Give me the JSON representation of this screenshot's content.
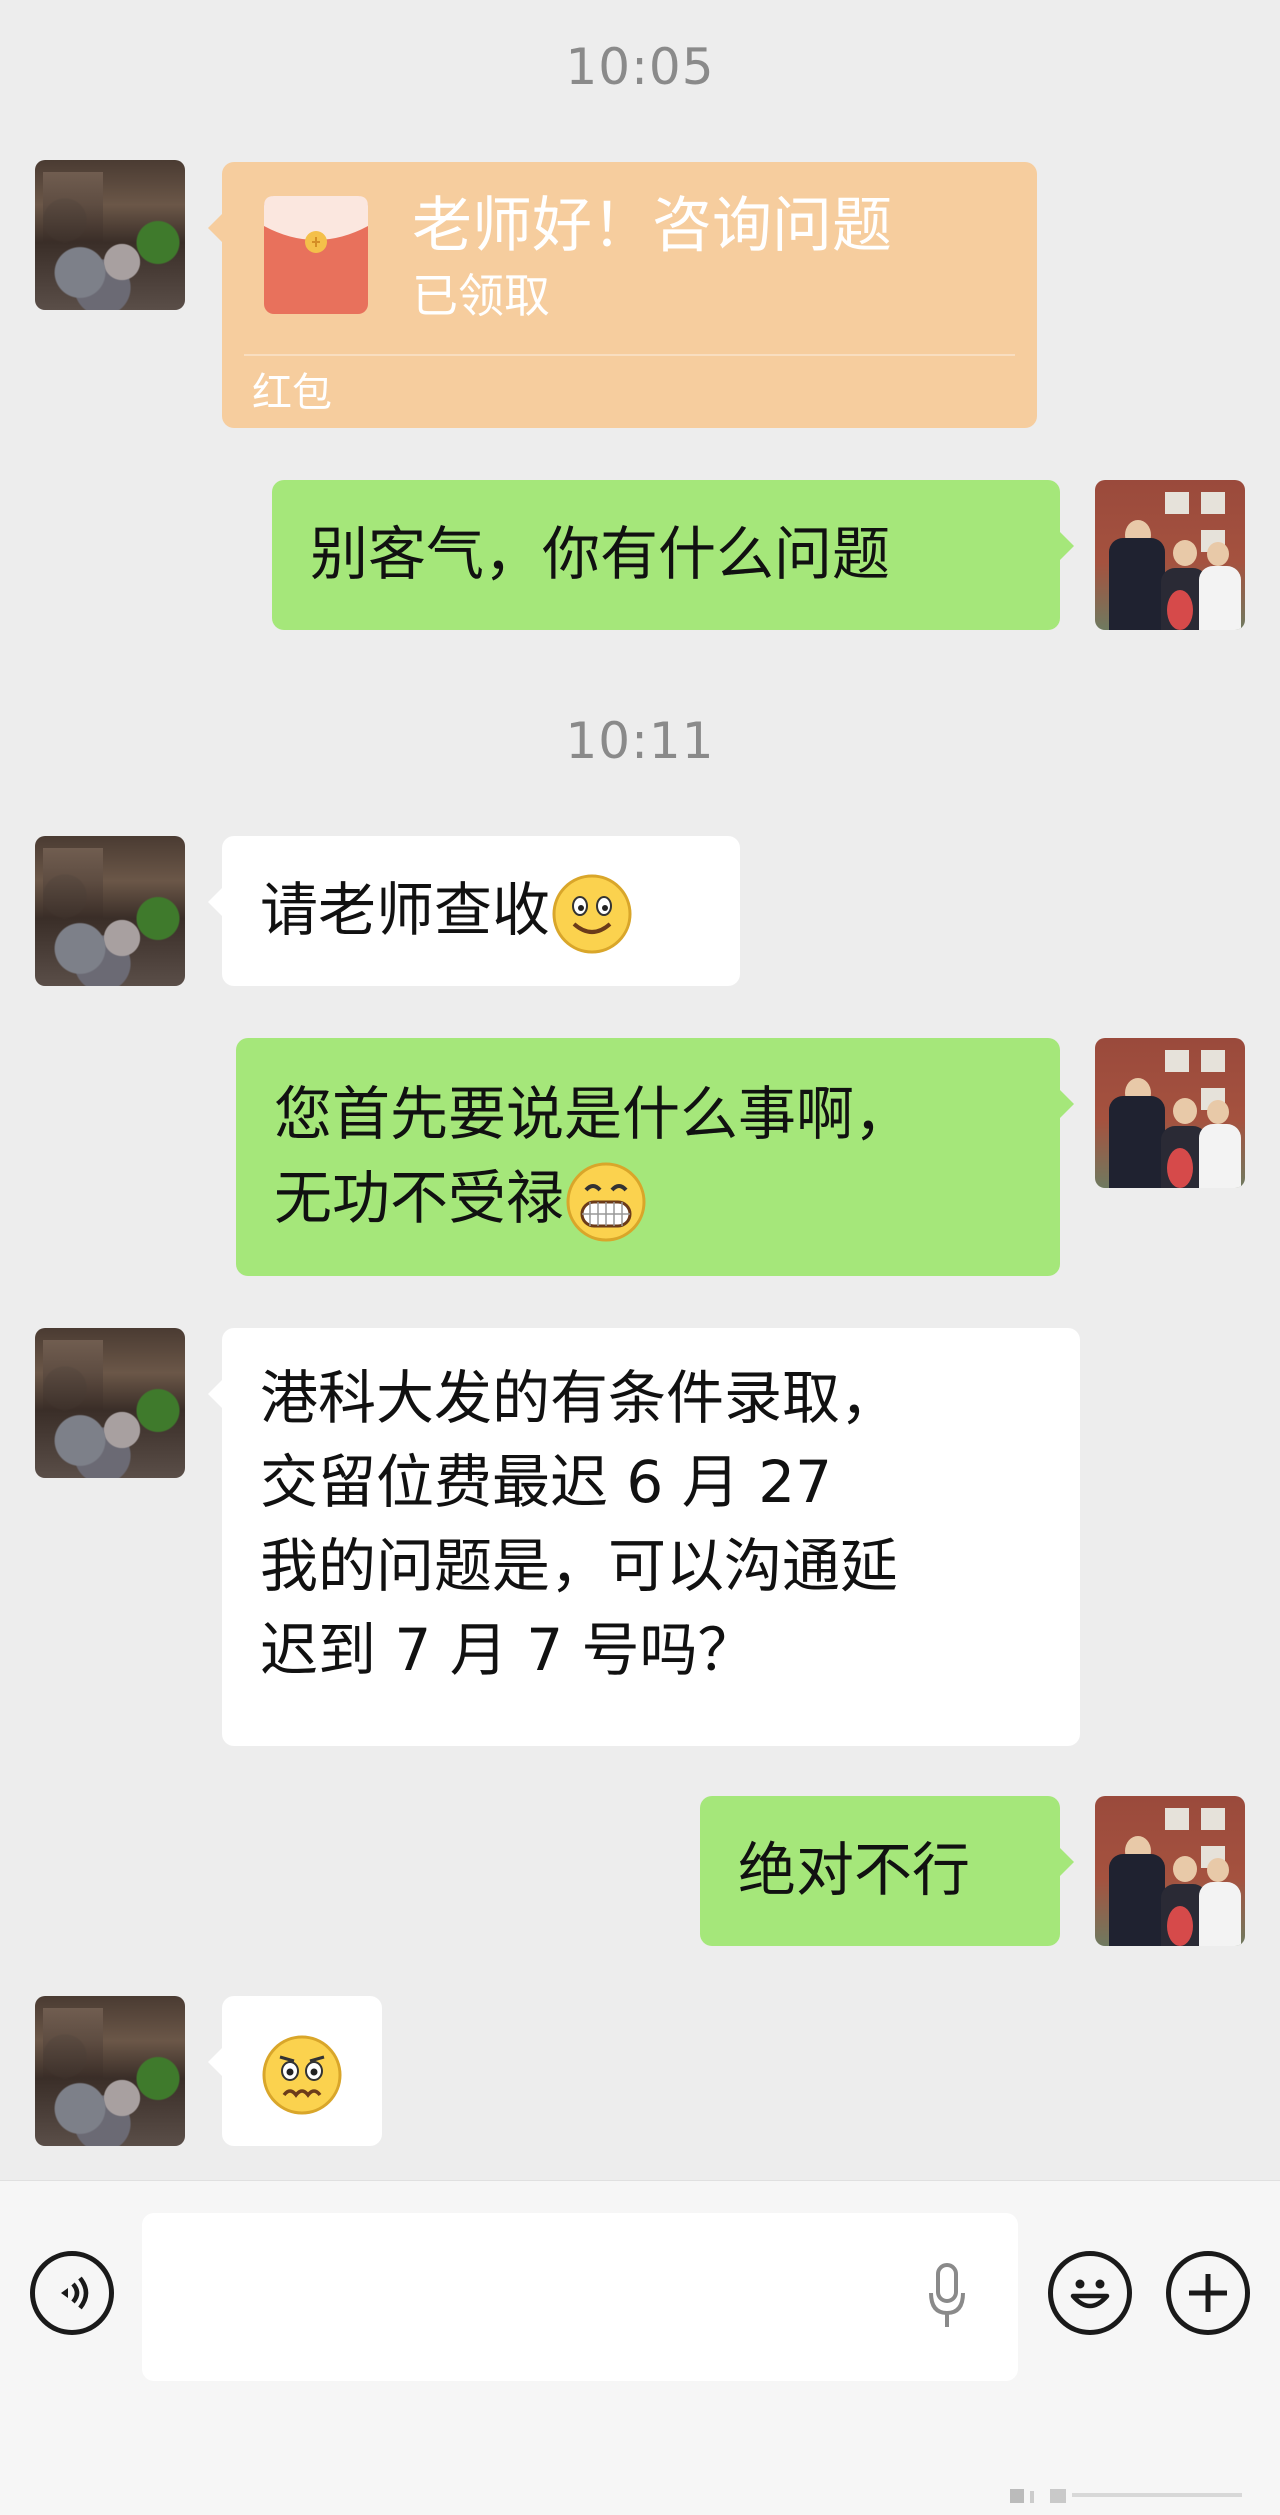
{
  "chat": {
    "timestamps": [
      "10:05",
      "10:11"
    ],
    "red_packet": {
      "title": "老师好！咨询问题",
      "status": "已领取",
      "label": "红包"
    },
    "messages": [
      {
        "side": "out",
        "text": "别客气，你有什么问题"
      },
      {
        "side": "in",
        "text": "请老师查收",
        "emoji": "smile-emoji-icon"
      },
      {
        "side": "out",
        "line1": "您首先要说是什么事啊，",
        "line2": "无功不受禄",
        "emoji": "grin-emoji-icon"
      },
      {
        "side": "in",
        "lines": [
          "港科大发的有条件录取，",
          "交留位费最迟 6 月 27",
          "我的问题是，可以沟通延",
          "迟到 7 月 7 号吗？"
        ]
      },
      {
        "side": "out",
        "text": "绝对不行"
      },
      {
        "side": "in",
        "emoji": "worried-emoji-icon"
      }
    ]
  },
  "input_bar": {
    "icons": [
      "voice-mode-icon",
      "microphone-icon",
      "emoji-icon",
      "add-icon"
    ]
  },
  "colors": {
    "background": "#ededed",
    "outgoing_bubble": "#a5e77a",
    "incoming_bubble": "#ffffff",
    "red_packet": "#f6cd9e",
    "timestamp": "#8a8a8a"
  }
}
